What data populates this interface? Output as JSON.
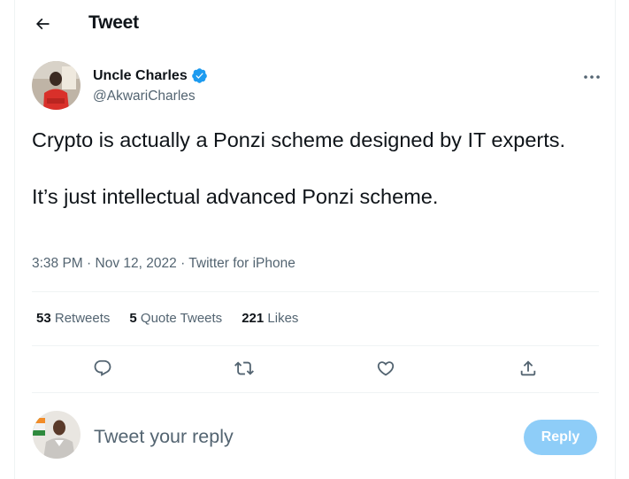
{
  "header": {
    "back_icon": "arrow-left-icon",
    "title": "Tweet"
  },
  "author": {
    "name": "Uncle Charles",
    "verified_icon": "verified-badge-icon",
    "handle": "@AkwariCharles",
    "more_icon": "more-horizontal-icon"
  },
  "tweet": {
    "paragraphs": [
      "Crypto is actually a Ponzi scheme designed by IT experts.",
      "It’s just intellectual advanced Ponzi scheme."
    ],
    "time": "3:38 PM",
    "date": "Nov 12, 2022",
    "source": "Twitter for iPhone",
    "separator": "·"
  },
  "stats": {
    "retweets_count": "53",
    "retweets_label": "Retweets",
    "quotes_count": "5",
    "quotes_label": "Quote Tweets",
    "likes_count": "221",
    "likes_label": "Likes"
  },
  "actions": {
    "reply_icon": "reply-icon",
    "retweet_icon": "retweet-icon",
    "like_icon": "like-icon",
    "share_icon": "share-icon"
  },
  "reply_box": {
    "placeholder": "Tweet your reply",
    "button_label": "Reply"
  },
  "colors": {
    "accent": "#1d9bf0",
    "reply_button_disabled": "#8ecdf8",
    "secondary_text": "#536471",
    "divider": "#eff3f4"
  }
}
